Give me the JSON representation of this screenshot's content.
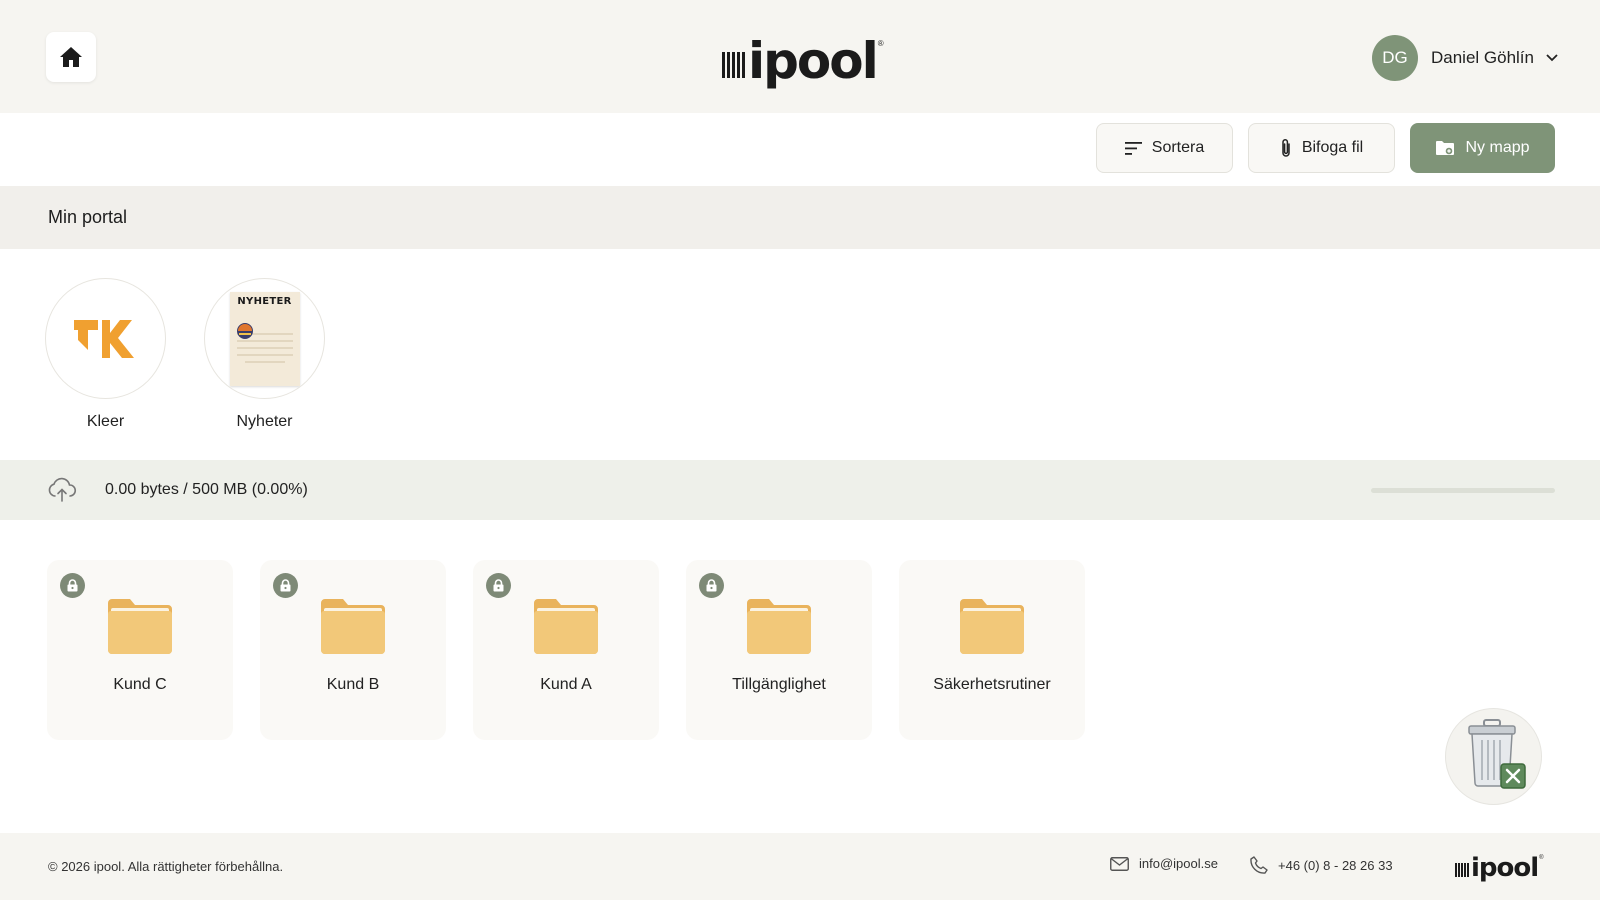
{
  "header": {
    "logo": "ipool",
    "user": {
      "initials": "DG",
      "name": "Daniel Göhlín"
    }
  },
  "toolbar": {
    "sort_label": "Sortera",
    "attach_label": "Bifoga fil",
    "new_folder_label": "Ny mapp"
  },
  "section": {
    "title": "Min portal"
  },
  "portal_apps": [
    {
      "label": "Kleer",
      "icon": "kleer-logo-icon"
    },
    {
      "label": "Nyheter",
      "icon": "newspaper-icon",
      "image_title": "NYHETER"
    }
  ],
  "storage": {
    "text": "0.00 bytes / 500 MB (0.00%)",
    "usage_percent": 0
  },
  "folders": [
    {
      "label": "Kund C",
      "locked": true
    },
    {
      "label": "Kund B",
      "locked": true
    },
    {
      "label": "Kund A",
      "locked": true
    },
    {
      "label": "Tillgänglighet",
      "locked": true
    },
    {
      "label": "Säkerhetsrutiner",
      "locked": false
    }
  ],
  "footer": {
    "copyright": "© 2026 ipool. Alla rättigheter förbehållna.",
    "email": "info@ipool.se",
    "phone": "+46 (0) 8 - 28 26 33",
    "logo": "ipool"
  },
  "colors": {
    "accent": "#7f9478",
    "header_bg": "#f6f5f1",
    "folder": "#f2c879",
    "kleer_orange": "#f0a030"
  }
}
